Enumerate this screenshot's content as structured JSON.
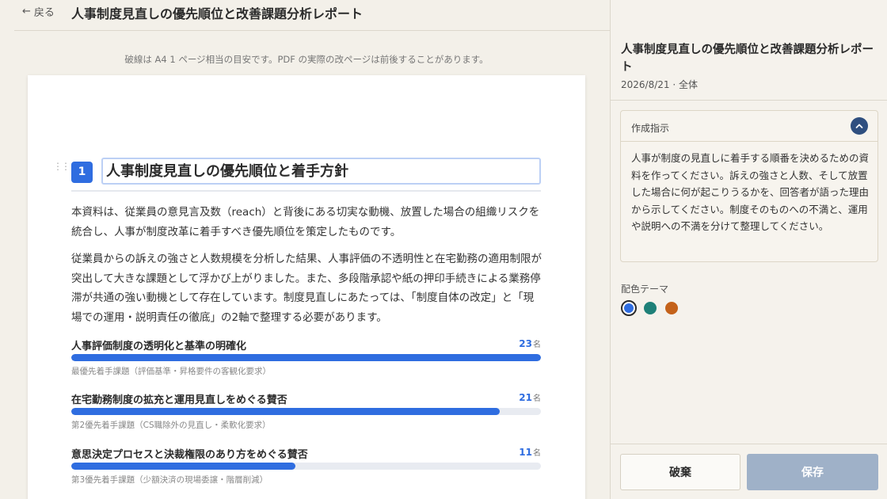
{
  "header": {
    "back_label": "戻る",
    "title": "人事制度見直しの優先順位と改善課題分析レポート"
  },
  "editor": {
    "page_hint": "破線は A4 1 ページ相当の目安です。PDF の実際の改ページは前後することがあります。",
    "section": {
      "number": "1",
      "title": "人事制度見直しの優先順位と着手方針",
      "paragraphs": [
        "本資料は、従業員の意見言及数（reach）と背後にある切実な動機、放置した場合の組織リスクを統合し、人事が制度改革に着手すべき優先順位を策定したものです。",
        "従業員からの訴えの強さと人数規模を分析した結果、人事評価の不透明性と在宅勤務の適用制限が突出して大きな課題として浮かび上がりました。また、多段階承認や紙の押印手続きによる業務停滞が共通の強い動機として存在しています。制度見直しにあたっては、「制度自体の改定」と「現場での運用・説明責任の徹底」の2軸で整理する必要があります。"
      ],
      "bars": [
        {
          "label": "人事評価制度の透明化と基準の明確化",
          "count": "23",
          "unit": "名",
          "fraction": 1.0,
          "sub": "最優先着手課題（評価基準・昇格要件の客観化要求）"
        },
        {
          "label": "在宅勤務制度の拡充と運用見直しをめぐる賛否",
          "count": "21",
          "unit": "名",
          "fraction": 0.913,
          "sub": "第2優先着手課題（CS職除外の見直し・柔軟化要求）"
        },
        {
          "label": "意思決定プロセスと決裁権限のあり方をめぐる賛否",
          "count": "11",
          "unit": "名",
          "fraction": 0.478,
          "sub": "第3優先着手課題（少額決済の現場委譲・階層削減）"
        }
      ]
    }
  },
  "sidebar": {
    "title": "人事制度見直しの優先順位と改善課題分析レポート",
    "meta": "2026/8/21 · 全体",
    "instructions": {
      "label": "作成指示",
      "body": "人事が制度の見直しに着手する順番を決めるための資料を作ってください。訴えの強さと人数、そして放置した場合に何が起こりうるかを、回答者が語った理由から示してください。制度そのものへの不満と、運用や説明への不満を分けて整理してください。"
    },
    "theme": {
      "label": "配色テーマ",
      "colors": [
        "#2f6de0",
        "#1e8078",
        "#c4621a"
      ],
      "selected": 0
    },
    "buttons": {
      "discard": "破棄",
      "save": "保存"
    }
  }
}
